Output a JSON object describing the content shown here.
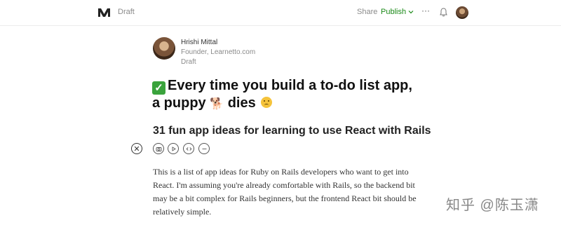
{
  "header": {
    "status": "Draft",
    "share_label": "Share",
    "publish_label": "Publish",
    "more_label": "···",
    "icons": [
      "medium-logo-icon",
      "chevron-down-icon",
      "more-icon",
      "bell-icon",
      "user-avatar"
    ]
  },
  "author": {
    "name": "Hrishi Mittal",
    "role": "Founder, Learnetto.com",
    "status": "Draft"
  },
  "story": {
    "title_part1": "Every time you build a to-do list app, a puppy",
    "title_part2": "dies",
    "subtitle": "31 fun app ideas for learning to use React with Rails",
    "paragraph": "This is a list of app ideas for Ruby on Rails developers who want to get into React. I'm assuming you're already comfortable with Rails, so the backend bit may be a bit complex for Rails beginners, but the frontend React bit should be relatively simple."
  },
  "insert_toolbar": {
    "icons": [
      "close-icon",
      "camera-icon",
      "video-icon",
      "embed-icon",
      "divider-icon"
    ]
  },
  "watermark": "知乎 @陈玉潇",
  "colors": {
    "accent": "#1a8917",
    "check_emoji_bg": "#3aa33c"
  }
}
